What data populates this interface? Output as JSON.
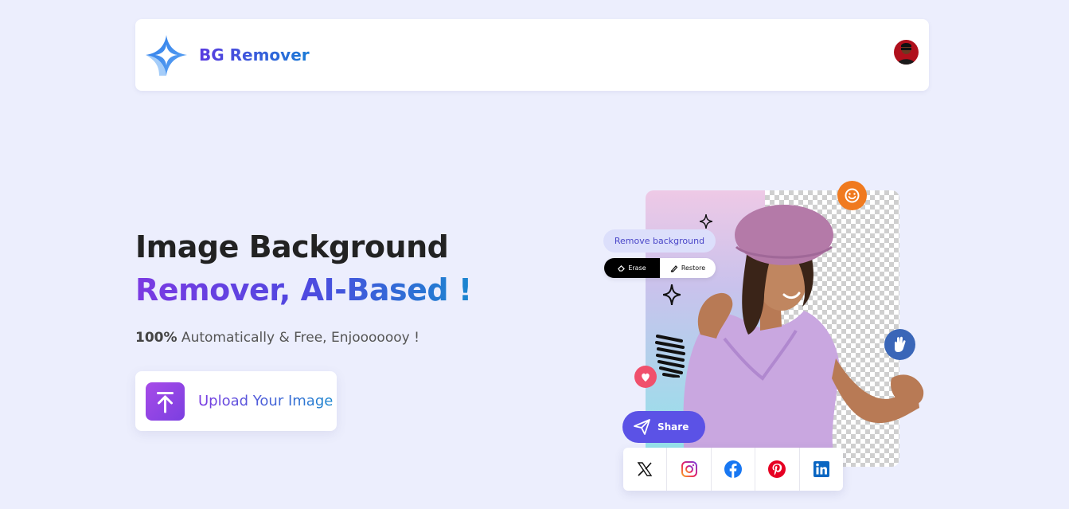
{
  "header": {
    "brand": "BG Remover",
    "logo_icon": "sparkle-logo-icon",
    "avatar": "user-avatar"
  },
  "hero": {
    "title_line1": "Image Background",
    "title_line2": "Remover, AI-Based !",
    "subtitle_bold": "100%",
    "subtitle_rest": " Automatically & Free, Enjooooooy !",
    "upload_label": "Upload Your Image",
    "upload_icon": "upload-arrow-icon"
  },
  "illustration": {
    "remove_background_label": "Remove background",
    "erase_label": "Erase",
    "restore_label": "Restore",
    "share_label": "Share",
    "badges": [
      "smile-icon",
      "hand-icon",
      "heart-icon"
    ],
    "social": [
      "x-icon",
      "instagram-icon",
      "facebook-icon",
      "pinterest-icon",
      "linkedin-icon"
    ]
  },
  "colors": {
    "background": "#eceefd",
    "accent_purple": "#7b3ae2",
    "accent_blue": "#1a86cf",
    "share": "#5b52e6",
    "orange": "#f07a1f"
  }
}
